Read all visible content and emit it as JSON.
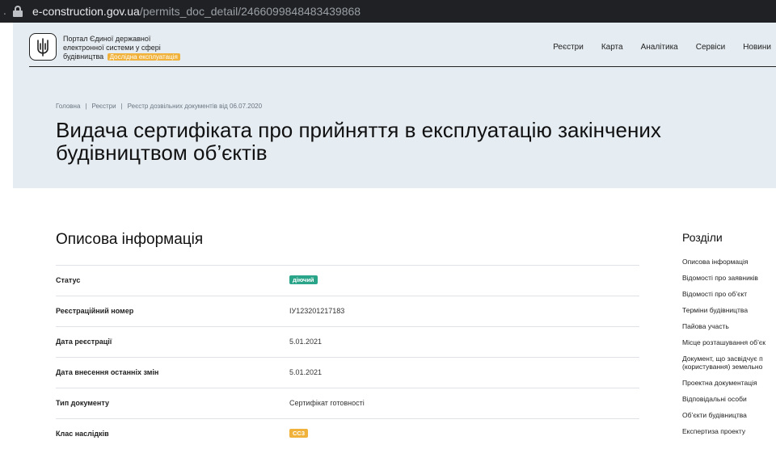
{
  "browser": {
    "url_host": "e-construction.gov.ua",
    "url_path": "/permits_doc_detail/2466099848483439868"
  },
  "header": {
    "brand_line1": "Портал Єдиної державної",
    "brand_line2": "електронної системи у сфері",
    "brand_line3": "будівництва",
    "beta_badge": "Дослідна експлуатація",
    "nav": [
      "Реєстри",
      "Карта",
      "Аналітика",
      "Сервіси",
      "Новини"
    ]
  },
  "breadcrumbs": [
    "Головна",
    "Реєстри",
    "Реєстр дозвільних документів від 06.07.2020"
  ],
  "page_title_line1": "Видача сертифіката про прийняття в експлуатацію закінчених",
  "page_title_line2": "будівництвом об’єктів",
  "section": {
    "title": "Описова інформація",
    "rows": [
      {
        "label": "Статус",
        "value": "діючий",
        "badge": "green"
      },
      {
        "label": "Реєстраційний номер",
        "value": "ІУ123201217183"
      },
      {
        "label": "Дата реєстрації",
        "value": "5.01.2021"
      },
      {
        "label": "Дата внесення останніх змін",
        "value": "5.01.2021"
      },
      {
        "label": "Тип документу",
        "value": "Сертифікат готовності"
      },
      {
        "label": "Клас наслідків",
        "value": "СС3",
        "badge": "orange"
      }
    ]
  },
  "sidebar": {
    "title": "Розділи",
    "items": [
      "Описова інформація",
      "Відомості про заявників",
      "Відомості про об’єкт",
      "Терміни будівництва",
      "Пайова участь",
      "Місце розташування об’єк",
      "Документ, що засвідчує п",
      "(користування) земельно",
      "Проектна документація",
      "Відповідальні особи",
      "Об’єкти будівництва",
      "Експертиза проекту"
    ]
  },
  "colors": {
    "hero_bg": "#e5ecf2",
    "status_green": "#2aa58a",
    "accent_orange": "#f0b23a"
  }
}
